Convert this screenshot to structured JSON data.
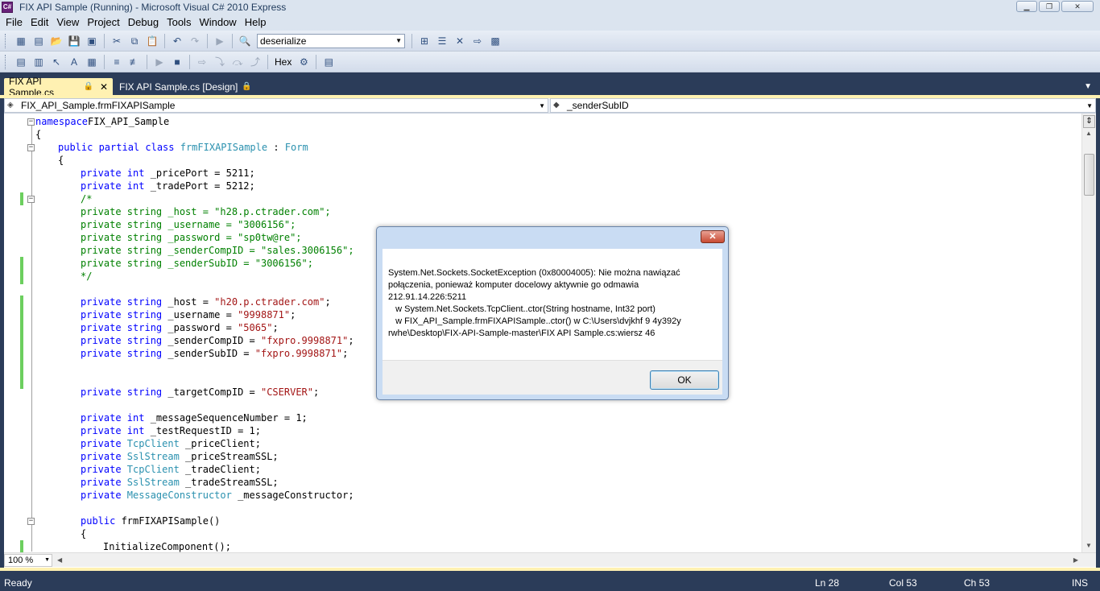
{
  "window": {
    "title": "FIX API Sample (Running) - Microsoft Visual C# 2010 Express",
    "app_icon_label": "C#",
    "controls": {
      "minimize": "▁",
      "restore": "❐",
      "close": "✕"
    }
  },
  "menu": {
    "items": [
      "File",
      "Edit",
      "View",
      "Project",
      "Debug",
      "Tools",
      "Window",
      "Help"
    ]
  },
  "toolbar1": {
    "find_combo_value": "deserialize",
    "icons": [
      "new-project-icon",
      "add-item-icon",
      "open-icon",
      "save-icon",
      "save-all-icon",
      "cut-icon",
      "copy-icon",
      "paste-icon",
      "undo-icon",
      "redo-icon",
      "start-icon",
      "find-in-files-icon",
      "solution-explorer-icon",
      "properties-icon",
      "toolbox-icon",
      "start-page-icon",
      "extension-manager-icon"
    ]
  },
  "toolbar2": {
    "hex_label": "Hex"
  },
  "tabs": {
    "active": {
      "label": "FIX API Sample.cs",
      "lock": "🔒",
      "close": "✕"
    },
    "inactive": {
      "label": "FIX API Sample.cs [Design]",
      "lock": "🔒"
    },
    "dropdown": "▼"
  },
  "navbar": {
    "class_combo": "FIX_API_Sample.frmFIXAPISample",
    "member_combo": "_senderSubID"
  },
  "code": {
    "lines": [
      {
        "text": [
          [
            "kw",
            "namespace"
          ],
          [
            "",
            "FIX_API_Sample"
          ]
        ],
        "indent": 0
      },
      {
        "text": [
          [
            "",
            "{"
          ]
        ],
        "indent": 0
      },
      {
        "text": [
          [
            "kw",
            "public partial class "
          ],
          [
            "ty",
            "frmFIXAPISample"
          ],
          [
            "",
            " : "
          ],
          [
            "ty",
            "Form"
          ]
        ],
        "indent": 1
      },
      {
        "text": [
          [
            "",
            "{"
          ]
        ],
        "indent": 1
      },
      {
        "text": [
          [
            "kw",
            "private int "
          ],
          [
            "",
            "_pricePort = 5211;"
          ]
        ],
        "indent": 2
      },
      {
        "text": [
          [
            "kw",
            "private int "
          ],
          [
            "",
            "_tradePort = 5212;"
          ]
        ],
        "indent": 2
      },
      {
        "text": [
          [
            "cm",
            "/*"
          ]
        ],
        "indent": 2
      },
      {
        "text": [
          [
            "cm",
            "private string _host = \"h28.p.ctrader.com\";"
          ]
        ],
        "indent": 2
      },
      {
        "text": [
          [
            "cm",
            "private string _username = \"3006156\";"
          ]
        ],
        "indent": 2
      },
      {
        "text": [
          [
            "cm",
            "private string _password = \"sp0tw@re\";"
          ]
        ],
        "indent": 2
      },
      {
        "text": [
          [
            "cm",
            "private string _senderCompID = \"sales.3006156\";"
          ]
        ],
        "indent": 2
      },
      {
        "text": [
          [
            "cm",
            "private string _senderSubID = \"3006156\";"
          ]
        ],
        "indent": 2
      },
      {
        "text": [
          [
            "cm",
            "*/"
          ]
        ],
        "indent": 2
      },
      {
        "text": [],
        "indent": 2
      },
      {
        "text": [
          [
            "kw",
            "private string "
          ],
          [
            "",
            "_host = "
          ],
          [
            "str",
            "\"h20.p.ctrader.com\""
          ],
          [
            "",
            ";"
          ]
        ],
        "indent": 2
      },
      {
        "text": [
          [
            "kw",
            "private string "
          ],
          [
            "",
            "_username = "
          ],
          [
            "str",
            "\"9998871\""
          ],
          [
            "",
            ";"
          ]
        ],
        "indent": 2
      },
      {
        "text": [
          [
            "kw",
            "private string "
          ],
          [
            "",
            "_password = "
          ],
          [
            "str",
            "\"5065\""
          ],
          [
            "",
            ";"
          ]
        ],
        "indent": 2
      },
      {
        "text": [
          [
            "kw",
            "private string "
          ],
          [
            "",
            "_senderCompID = "
          ],
          [
            "str",
            "\"fxpro.9998871\""
          ],
          [
            "",
            ";"
          ]
        ],
        "indent": 2
      },
      {
        "text": [
          [
            "kw",
            "private string "
          ],
          [
            "",
            "_senderSubID = "
          ],
          [
            "str",
            "\"fxpro.9998871\""
          ],
          [
            "",
            ";"
          ]
        ],
        "indent": 2
      },
      {
        "text": [],
        "indent": 2
      },
      {
        "text": [],
        "indent": 2
      },
      {
        "text": [
          [
            "kw",
            "private string "
          ],
          [
            "",
            "_targetCompID = "
          ],
          [
            "str",
            "\"CSERVER\""
          ],
          [
            "",
            ";"
          ]
        ],
        "indent": 2
      },
      {
        "text": [],
        "indent": 2
      },
      {
        "text": [
          [
            "kw",
            "private int "
          ],
          [
            "",
            "_messageSequenceNumber = 1;"
          ]
        ],
        "indent": 2
      },
      {
        "text": [
          [
            "kw",
            "private int "
          ],
          [
            "",
            "_testRequestID = 1;"
          ]
        ],
        "indent": 2
      },
      {
        "text": [
          [
            "kw",
            "private "
          ],
          [
            "ty",
            "TcpClient"
          ],
          [
            "",
            " _priceClient;"
          ]
        ],
        "indent": 2
      },
      {
        "text": [
          [
            "kw",
            "private "
          ],
          [
            "ty",
            "SslStream"
          ],
          [
            "",
            " _priceStreamSSL;"
          ]
        ],
        "indent": 2
      },
      {
        "text": [
          [
            "kw",
            "private "
          ],
          [
            "ty",
            "TcpClient"
          ],
          [
            "",
            " _tradeClient;"
          ]
        ],
        "indent": 2
      },
      {
        "text": [
          [
            "kw",
            "private "
          ],
          [
            "ty",
            "SslStream"
          ],
          [
            "",
            " _tradeStreamSSL;"
          ]
        ],
        "indent": 2
      },
      {
        "text": [
          [
            "kw",
            "private "
          ],
          [
            "ty",
            "MessageConstructor"
          ],
          [
            "",
            " _messageConstructor;"
          ]
        ],
        "indent": 2
      },
      {
        "text": [],
        "indent": 2
      },
      {
        "text": [
          [
            "kw",
            "public "
          ],
          [
            "",
            "frmFIXAPISample()"
          ]
        ],
        "indent": 2
      },
      {
        "text": [
          [
            "",
            "{"
          ]
        ],
        "indent": 2
      },
      {
        "text": [
          [
            "",
            "InitializeComponent();"
          ]
        ],
        "indent": 3
      }
    ]
  },
  "zoom": "100 %",
  "status": {
    "text": "Ready",
    "line": "Ln 28",
    "col": "Col 53",
    "ch": "Ch 53",
    "mode": "INS"
  },
  "dialog": {
    "message": "System.Net.Sockets.SocketException (0x80004005): Nie można nawiązać połączenia, ponieważ komputer docelowy aktywnie go odmawia 212.91.14.226:5211\n   w System.Net.Sockets.TcpClient..ctor(String hostname, Int32 port)\n   w FIX_API_Sample.frmFIXAPISample..ctor() w C:\\Users\\dvjkhf 9 4y392y rwhe\\Desktop\\FIX-API-Sample-master\\FIX API Sample.cs:wiersz 46",
    "ok_label": "OK",
    "close_glyph": "✕"
  }
}
